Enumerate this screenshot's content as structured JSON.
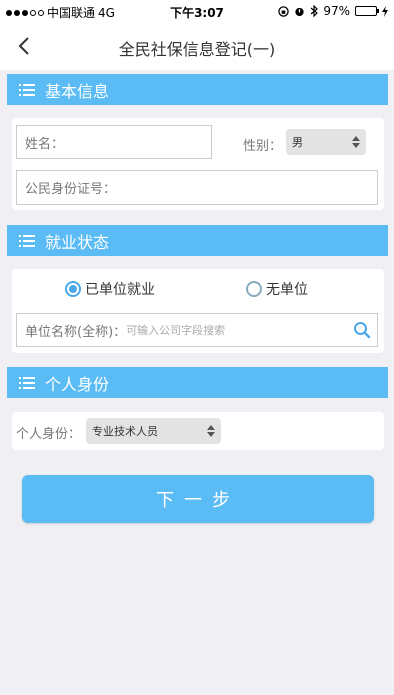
{
  "status_bar": {
    "carrier": "中国联通",
    "network": "4G",
    "time": "下午3:07",
    "battery_percent_text": "97%",
    "battery_level": 0.97
  },
  "nav": {
    "title": "全民社保信息登记(一)"
  },
  "sections": {
    "basic": "基本信息",
    "employment": "就业状态",
    "identity": "个人身份"
  },
  "basic_info": {
    "name_label": "姓名：",
    "gender_label": "性别：",
    "gender_value": "男",
    "id_label": "公民身份证号："
  },
  "employment": {
    "option_employed": "已单位就业",
    "option_unemployed": "无单位",
    "employer_label": "单位名称(全称)：",
    "employer_placeholder": "可输入公司字段搜索"
  },
  "identity": {
    "label": "个人身份：",
    "value": "专业技术人员"
  },
  "next_button": "下一步",
  "colors": {
    "accent": "#5bbcf5",
    "radio": "#4aa8e8",
    "battery": "#4cd964"
  }
}
